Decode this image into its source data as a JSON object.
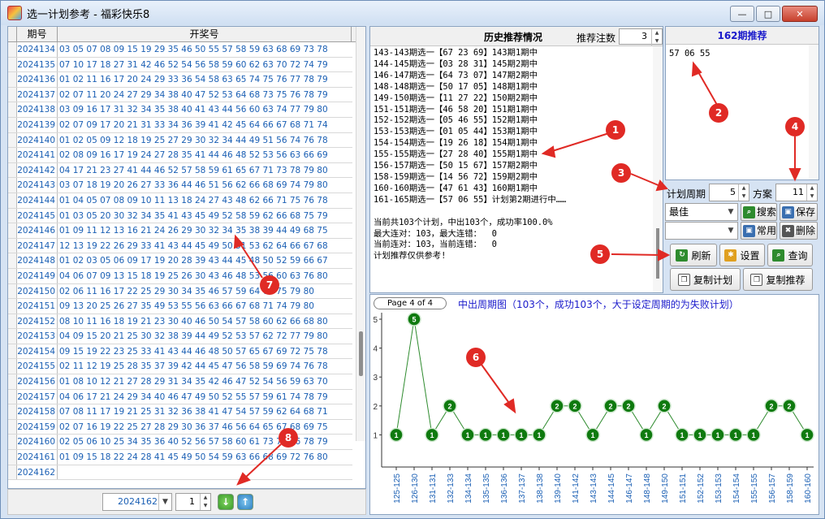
{
  "window": {
    "title": "选一计划参考 - 福彩快乐8",
    "minimize": "—",
    "maximize": "□",
    "close": "✕"
  },
  "grid": {
    "col_period": "期号",
    "col_numbers": "开奖号",
    "rows": [
      {
        "period": "2024134",
        "numbers": "03 05 07 08 09 15 19 29 35 46 50 55 57 58 59 63 68 69 73 78"
      },
      {
        "period": "2024135",
        "numbers": "07 10 17 18 27 31 42 46 52 54 56 58 59 60 62 63 70 72 74 79"
      },
      {
        "period": "2024136",
        "numbers": "01 02 11 16 17 20 24 29 33 36 54 58 63 65 74 75 76 77 78 79"
      },
      {
        "period": "2024137",
        "numbers": "02 07 11 20 24 27 29 34 38 40 47 52 53 64 68 73 75 76 78 79"
      },
      {
        "period": "2024138",
        "numbers": "03 09 16 17 31 32 34 35 38 40 41 43 44 56 60 63 74 77 79 80"
      },
      {
        "period": "2024139",
        "numbers": "02 07 09 17 20 21 31 33 34 36 39 41 42 45 64 66 67 68 71 74"
      },
      {
        "period": "2024140",
        "numbers": "01 02 05 09 12 18 19 25 27 29 30 32 34 44 49 51 56 74 76 78"
      },
      {
        "period": "2024141",
        "numbers": "02 08 09 16 17 19 24 27 28 35 41 44 46 48 52 53 56 63 66 69"
      },
      {
        "period": "2024142",
        "numbers": "04 17 21 23 27 41 44 46 52 57 58 59 61 65 67 71 73 78 79 80"
      },
      {
        "period": "2024143",
        "numbers": "03 07 18 19 20 26 27 33 36 44 46 51 56 62 66 68 69 74 79 80"
      },
      {
        "period": "2024144",
        "numbers": "01 04 05 07 08 09 10 11 13 18 24 27 43 48 62 66 71 75 76 78"
      },
      {
        "period": "2024145",
        "numbers": "01 03 05 20 30 32 34 35 41 43 45 49 52 58 59 62 66 68 75 79"
      },
      {
        "period": "2024146",
        "numbers": "01 09 11 12 13 16 21 24 26 29 30 32 34 35 38 39 44 49 68 75"
      },
      {
        "period": "2024147",
        "numbers": "12 13 19 22 26 29 33 41 43 44 45 49 50 51 53 62 64 66 67 68"
      },
      {
        "period": "2024148",
        "numbers": "01 02 03 05 06 09 17 19 20 28 39 43 44 45 48 50 52 59 66 67"
      },
      {
        "period": "2024149",
        "numbers": "04 06 07 09 13 15 18 19 25 26 30 43 46 48 53 56 60 63 76 80"
      },
      {
        "period": "2024150",
        "numbers": "02 06 11 16 17 22 25 29 30 34 35 46 57 59 64 71 75 79 80"
      },
      {
        "period": "2024151",
        "numbers": "09 13 20 25 26 27 35 49 53 55 56 63 66 67 68 71 74 79 80"
      },
      {
        "period": "2024152",
        "numbers": "08 10 11 16 18 19 21 23 30 40 46 50 54 57 58 60 62 66 68 80"
      },
      {
        "period": "2024153",
        "numbers": "04 09 15 20 21 25 30 32 38 39 44 49 52 53 57 62 72 77 79 80"
      },
      {
        "period": "2024154",
        "numbers": "09 15 19 22 23 25 33 41 43 44 46 48 50 57 65 67 69 72 75 78"
      },
      {
        "period": "2024155",
        "numbers": "02 11 12 19 25 28 35 37 39 42 44 45 47 56 58 59 69 74 76 78"
      },
      {
        "period": "2024156",
        "numbers": "01 08 10 12 21 27 28 29 31 34 35 42 46 47 52 54 56 59 63 70"
      },
      {
        "period": "2024157",
        "numbers": "04 06 17 21 24 29 34 40 46 47 49 50 52 55 57 59 61 74 78 79"
      },
      {
        "period": "2024158",
        "numbers": "07 08 11 17 19 21 25 31 32 36 38 41 47 54 57 59 62 64 68 71"
      },
      {
        "period": "2024159",
        "numbers": "02 07 16 19 22 25 27 28 29 30 36 37 46 56 64 65 67 68 69 75"
      },
      {
        "period": "2024160",
        "numbers": "02 05 06 10 25 34 35 36 40 52 56 57 58 60 61 73 74 76 78 79"
      },
      {
        "period": "2024161",
        "numbers": "01 09 15 18 22 24 28 41 45 49 50 54 59 63 66 68 69 72 76 80"
      },
      {
        "period": "2024162",
        "numbers": ""
      }
    ]
  },
  "footer": {
    "period_select": "2024162",
    "page_value": "1"
  },
  "history": {
    "title": "历史推荐情况",
    "count_label": "推荐注数",
    "count_value": "3",
    "text": "143-143期选一【67 23 69】143期1期中\n144-145期选一【03 28 31】145期2期中\n146-147期选一【64 73 07】147期2期中\n148-148期选一【50 17 05】148期1期中\n149-150期选一【11 27 22】150期2期中\n151-151期选一【46 58 20】151期1期中\n152-152期选一【05 46 55】152期1期中\n153-153期选一【01 05 44】153期1期中\n154-154期选一【19 26 18】154期1期中\n155-155期选一【27 28 40】155期1期中\n156-157期选一【50 15 67】157期2期中\n158-159期选一【14 56 72】159期2期中\n160-160期选一【47 61 43】160期1期中\n161-165期选一【57 06 55】计划第2期进行中……\n\n当前共103个计划，中出103个，成功率100.0%\n最大连对：103，最大连错：  0\n当前连对：103，当前连错：  0\n计划推荐仅供参考!"
  },
  "recommend": {
    "title": "162期推荐",
    "numbers": "57 06 55"
  },
  "controls": {
    "cycle_label": "计划周期",
    "cycle_value": "5",
    "scheme_label": "方案",
    "scheme_value": "11",
    "best_combo": "最佳",
    "search": "搜索",
    "save": "保存",
    "common": "常用",
    "delete": "删除",
    "refresh": "刷新",
    "settings": "设置",
    "query": "查询",
    "copy_plan": "复制计划",
    "copy_recommend": "复制推荐"
  },
  "chart_data": {
    "type": "line",
    "pager": "Page 4 of 4",
    "title": "中出周期图（103个，成功103个，大于设定周期的为失败计划）",
    "categories": [
      "125-125",
      "126-130",
      "131-131",
      "132-133",
      "134-134",
      "135-135",
      "136-136",
      "137-137",
      "138-138",
      "139-140",
      "141-142",
      "143-143",
      "144-145",
      "146-147",
      "148-148",
      "149-150",
      "151-151",
      "152-152",
      "153-153",
      "154-154",
      "155-155",
      "156-157",
      "158-159",
      "160-160"
    ],
    "values": [
      1,
      5,
      1,
      2,
      1,
      1,
      1,
      1,
      1,
      2,
      2,
      1,
      2,
      2,
      1,
      2,
      1,
      1,
      1,
      1,
      1,
      2,
      2,
      1
    ],
    "ylim": [
      0,
      5
    ],
    "yticks": [
      1,
      2,
      3,
      4,
      5
    ],
    "line_color": "#2e8b2e",
    "marker_color": "#0f7a0f"
  },
  "annotations": [
    "1",
    "2",
    "3",
    "4",
    "5",
    "6",
    "7",
    "8"
  ],
  "colors": {
    "callout": "#e02a25",
    "link_blue": "#1a5fb4"
  }
}
